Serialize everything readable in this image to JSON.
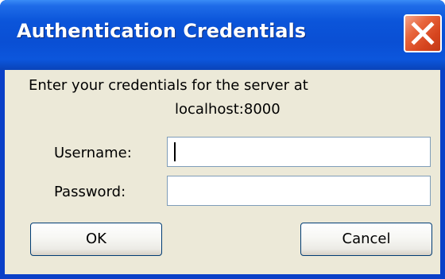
{
  "window": {
    "title": "Authentication Credentials",
    "close_icon": "close-icon"
  },
  "dialog": {
    "prompt_line1": "Enter your credentials for the server at",
    "prompt_line2": "localhost:8000",
    "username_label": "Username:",
    "username_value": "",
    "password_label": "Password:",
    "password_value": "",
    "ok_label": "OK",
    "cancel_label": "Cancel"
  },
  "colors": {
    "titlebar": "#0b55da",
    "close_button": "#d6451f",
    "dialog_bg": "#ece9d8",
    "field_border": "#7f9db9"
  }
}
